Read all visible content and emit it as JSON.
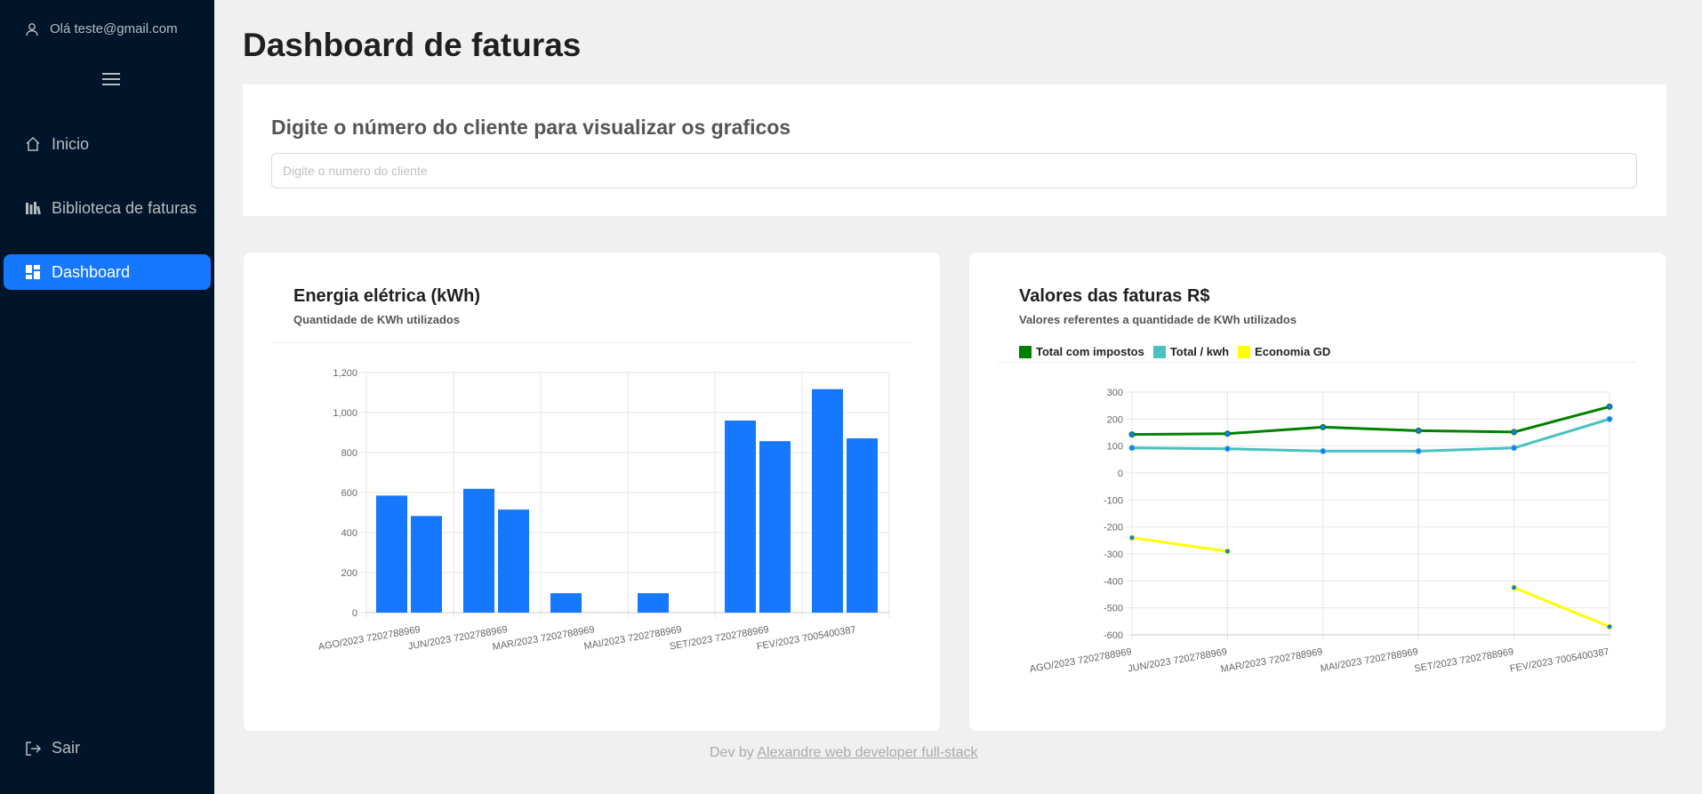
{
  "sidebar": {
    "user_greeting": "Olá teste@gmail.com",
    "items": [
      {
        "label": "Inicio",
        "icon": "home-icon"
      },
      {
        "label": "Biblioteca de faturas",
        "icon": "library-icon"
      },
      {
        "label": "Dashboard",
        "icon": "dashboard-icon",
        "active": true
      }
    ],
    "logout_label": "Sair"
  },
  "page": {
    "title": "Dashboard de faturas"
  },
  "search": {
    "heading": "Digite o número do cliente para visualizar os graficos",
    "placeholder": "Digite o numero do cliente",
    "value": ""
  },
  "footer": {
    "prefix": "Dev by",
    "link_text": "Alexandre web developer full-stack"
  },
  "colors": {
    "accent": "#1677ff",
    "sidebar_bg": "#001529",
    "total_com_impostos": "#008000",
    "total_kwh": "#4bc0c0",
    "economia_gd": "#ffff00"
  },
  "chart_data": [
    {
      "type": "bar",
      "title": "Energia elétrica (kWh)",
      "subtitle": "Quantidade de KWh utilizados",
      "categories": [
        "AGO/2023 7202788969",
        "JUN/2023 7202788969",
        "MAR/2023 7202788969",
        "MAI/2023 7202788969",
        "SET/2023 7202788969",
        "FEV/2023 7005400387"
      ],
      "series": [
        {
          "values": [
            585,
            483,
            619,
            515,
            97,
            0,
            97,
            0,
            960,
            857,
            1117,
            871
          ]
        }
      ],
      "bar_pairs": [
        [
          585,
          483
        ],
        [
          619,
          515
        ],
        [
          97,
          0
        ],
        [
          97,
          0
        ],
        [
          960,
          857
        ],
        [
          1117,
          871
        ]
      ],
      "ylim": [
        0,
        1200
      ],
      "yticks": [
        "0",
        "200",
        "400",
        "600",
        "800",
        "1,000",
        "1,200"
      ],
      "grid": true
    },
    {
      "type": "line",
      "title": "Valores das faturas R$",
      "subtitle": "Valores referentes a quantidade de KWh utilizados",
      "categories": [
        "AGO/2023 7202788969",
        "JUN/2023 7202788969",
        "MAR/2023 7202788969",
        "MAI/2023 7202788969",
        "SET/2023 7202788969",
        "FEV/2023 7005400387"
      ],
      "series": [
        {
          "name": "Total com impostos",
          "color": "#008000",
          "values": [
            143,
            146,
            170,
            157,
            152,
            246
          ]
        },
        {
          "name": "Total / kwh",
          "color": "#4bc0c0",
          "values": [
            93,
            90,
            81,
            81,
            93,
            200
          ]
        },
        {
          "name": "Economia GD",
          "color": "#ffff00",
          "values": [
            -240,
            -290,
            null,
            null,
            -425,
            -570
          ]
        }
      ],
      "ylim": [
        -600,
        300
      ],
      "yticks": [
        "300",
        "200",
        "100",
        "0",
        "-100",
        "-200",
        "-300",
        "-400",
        "-500",
        "-600"
      ],
      "legend": "top-left",
      "grid": true
    }
  ]
}
